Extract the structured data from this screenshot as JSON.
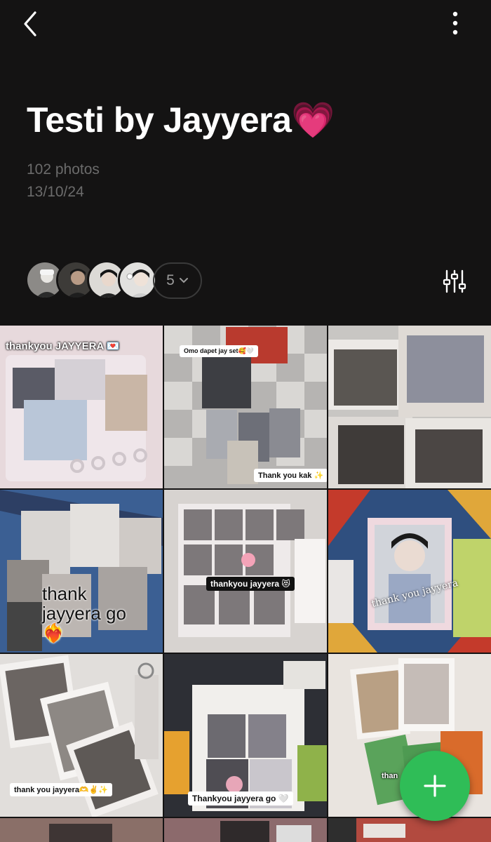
{
  "header": {
    "back_icon": "chevron-left-icon",
    "more_icon": "vertical-ellipsis-icon"
  },
  "album": {
    "title": "Testi by Jayyera💗",
    "photo_count": "102 photos",
    "date": "13/10/24"
  },
  "members": {
    "avatars": [
      "member-avatar-1",
      "member-avatar-2",
      "member-avatar-3",
      "member-avatar-4"
    ],
    "more_count": "5",
    "more_icon": "chevron-down-icon"
  },
  "filter_icon": "sliders-icon",
  "photos": [
    {
      "caption": "thankyou JAYYERA 💌"
    },
    {
      "caption": "Omo dapet jay set🥰🤍",
      "caption2": "Thank you kak ✨"
    },
    {
      "caption": ""
    },
    {
      "caption": "thank jayyera go ❤️‍🔥"
    },
    {
      "caption": "thankyou jayyera 😻"
    },
    {
      "caption": "thank you jayyera"
    },
    {
      "caption": "thank you jayyera🫶✌️✨"
    },
    {
      "caption": "Thankyou jayyera go 🤍"
    },
    {
      "caption": "than"
    }
  ],
  "fab": {
    "icon": "plus-icon"
  },
  "colors": {
    "background": "#141313",
    "meta_text": "#6b6b6b",
    "fab": "#2fbd57"
  }
}
